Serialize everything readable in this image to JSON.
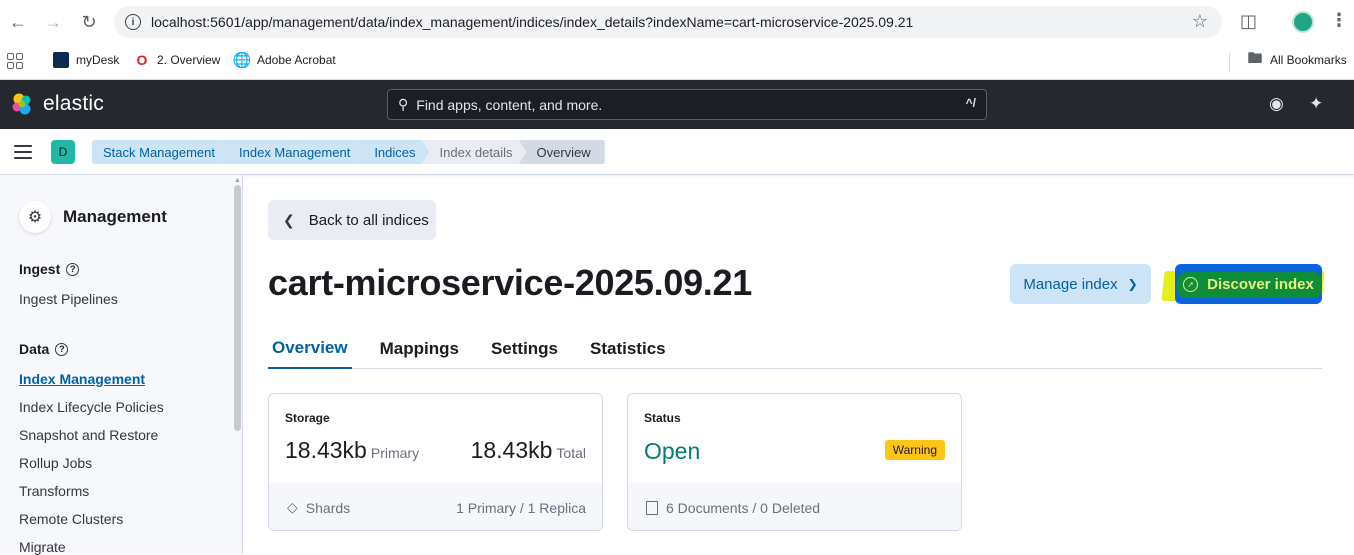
{
  "browser": {
    "url": "localhost:5601/app/management/data/index_management/indices/index_details?indexName=cart-microservice-2025.09.21",
    "bookmarks": [
      {
        "label": "myDesk",
        "icon": "mydesk-icon"
      },
      {
        "label": "2. Overview",
        "icon": "overview-icon"
      },
      {
        "label": "Adobe Acrobat",
        "icon": "globe-icon"
      }
    ],
    "all_bookmarks_label": "All Bookmarks"
  },
  "header": {
    "brand": "elastic",
    "search_placeholder": "Find apps, content, and more.",
    "search_shortcut": "^/"
  },
  "breadcrumbs": {
    "space_initial": "D",
    "items": [
      "Stack Management",
      "Index Management",
      "Indices",
      "Index details",
      "Overview"
    ]
  },
  "sidenav": {
    "title": "Management",
    "groups": [
      {
        "label": "Ingest",
        "items": [
          "Ingest Pipelines"
        ]
      },
      {
        "label": "Data",
        "items": [
          "Index Management",
          "Index Lifecycle Policies",
          "Snapshot and Restore",
          "Rollup Jobs",
          "Transforms",
          "Remote Clusters",
          "Migrate"
        ]
      }
    ],
    "active_item": "Index Management"
  },
  "main": {
    "back_label": "Back to all indices",
    "title": "cart-microservice-2025.09.21",
    "manage_label": "Manage index",
    "discover_label": "Discover index",
    "tabs": [
      "Overview",
      "Mappings",
      "Settings",
      "Statistics"
    ],
    "active_tab": "Overview"
  },
  "storage_card": {
    "label": "Storage",
    "primary_value": "18.43kb",
    "primary_unit": "Primary",
    "total_value": "18.43kb",
    "total_unit": "Total",
    "shards_label": "Shards",
    "shards_value": "1 Primary / 1 Replica"
  },
  "status_card": {
    "label": "Status",
    "value": "Open",
    "badge": "Warning",
    "documents": "6 Documents / 0 Deleted"
  },
  "colors": {
    "header_bg": "#25282f",
    "link": "#0061a6",
    "status_open": "#017d73",
    "warning": "#fec514",
    "primary_button": "#0b64dd"
  }
}
